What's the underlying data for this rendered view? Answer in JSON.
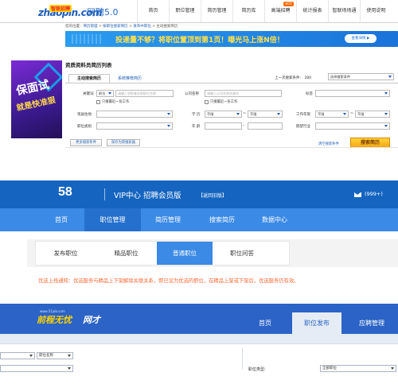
{
  "zhaopin": {
    "logo_brand": "zhaopin.com",
    "logo_cn": "智联招聘",
    "product": "网聘5.0",
    "nav": [
      "首页",
      "职位管理",
      "简历管理",
      "简历库",
      "高端招聘",
      "统计报表",
      "智联场场通",
      "使用说明"
    ],
    "nav_hot": "HOT",
    "breadcrumb": {
      "prefix": "您的位置：",
      "items": [
        "简历管理",
        "按职位搜索简历",
        "发布中职位",
        "主动搜索简历"
      ],
      "sep": " > "
    },
    "banner": {
      "text": "投递量不够？将职位置顶到第1页！曝光马上涨N倍！",
      "button": "查看详情 ▶"
    },
    "ad": {
      "line1": "保面试",
      "line2": "就是快准狠"
    },
    "page_title": "资质资料员简历列表",
    "tabs": {
      "active": "主动搜索简历",
      "other": "系统推荐简历"
    },
    "last_conditions": {
      "label": "上一次搜索条件：",
      "count": "280",
      "select": "选择搜索条件"
    },
    "form": {
      "keyword_label": "关键词",
      "keyword_type": "职位",
      "keyword_placeholder": "请输入求职者在职职位名称",
      "keyword_only_latest": "只搜最近一份工作",
      "company_label": "公司名称",
      "company_placeholder": "请输入公司名称关键词",
      "company_only_latest": "只搜最近一份工作",
      "tag_label": "标签",
      "location_label": "现居住地",
      "education_label": "学 历",
      "education_from": "不限",
      "education_to": "不限",
      "experience_label": "工作年限",
      "experience_from": "不限",
      "experience_to": "不限",
      "category_label": "职位类别",
      "age_label": "年 龄",
      "industry_label": "期望行业",
      "range_sep": "~",
      "age_sep": "-"
    },
    "buttons": {
      "more": "更多搜索条件",
      "save": "保存为新搜索器",
      "clear": "清空搜索条件",
      "search": "搜索简历"
    }
  },
  "job58": {
    "logo": "58",
    "vip_title": "VIP中心 招聘会员版",
    "back_old": "【返回旧版】",
    "message_count": "(999+)",
    "nav": [
      "首页",
      "职位管理",
      "简历管理",
      "搜索简历",
      "数据中心"
    ],
    "subnav": [
      "发布职位",
      "精品职位",
      "普通职位",
      "职位问答"
    ],
    "notice": "优选上线通知：优选服务与精品上下架解除关联关系，即已设为优选的职位，在精品上架或下架后，优选服务仍有效。"
  },
  "job51": {
    "logo_small": "www.51job.com",
    "logo_a": "前程无忧",
    "logo_b": "网才",
    "nav": [
      "首页",
      "职位发布",
      "应聘管理"
    ],
    "position_name_select": "职位名称",
    "position_type_label": "职位类型:",
    "position_type_value": "全部职位"
  },
  "colors": {
    "zhaopin_blue": "#1f5fb6",
    "search_orange": "#f7a60f",
    "job58_blue": "#1565c0",
    "job58_nav": "#3b8ae6",
    "notice_orange": "#ff6a36",
    "job51_blue": "#2b63c6"
  }
}
